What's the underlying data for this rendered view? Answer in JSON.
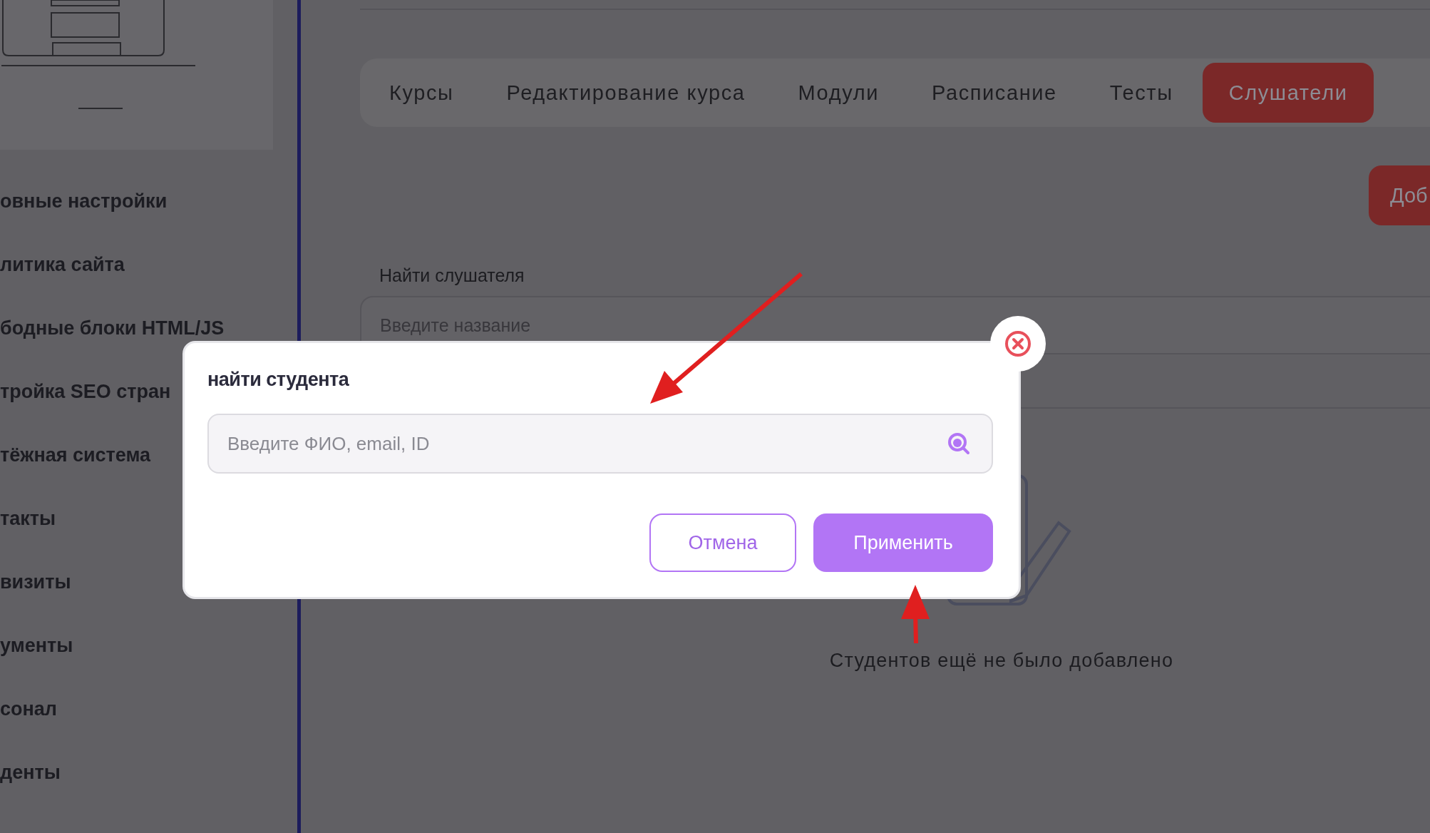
{
  "sidebar": {
    "items": [
      {
        "label": "овные настройки"
      },
      {
        "label": "литика сайта"
      },
      {
        "label": "бодные блоки HTML/JS"
      },
      {
        "label": "тройка SEO стран"
      },
      {
        "label": "тёжная система"
      },
      {
        "label": "такты"
      },
      {
        "label": "визиты"
      },
      {
        "label": "ументы"
      },
      {
        "label": "сонал"
      },
      {
        "label": "денты"
      }
    ]
  },
  "tabs": [
    {
      "label": "Курсы",
      "selected": false
    },
    {
      "label": "Редактирование курса",
      "selected": false
    },
    {
      "label": "Модули",
      "selected": false
    },
    {
      "label": "Расписание",
      "selected": false
    },
    {
      "label": "Тесты",
      "selected": false
    },
    {
      "label": "Слушатели",
      "selected": true
    }
  ],
  "add_button": {
    "label": "Доб"
  },
  "search": {
    "label": "Найти слушателя",
    "placeholder": "Введите название"
  },
  "empty_state": {
    "text": "Студентов ещё не было добавлено"
  },
  "dialog": {
    "title": "найти студента",
    "search": {
      "placeholder": "Введите ФИО, email, ID"
    },
    "buttons": [
      {
        "label": "Отмена",
        "kind": "secondary"
      },
      {
        "label": "Применить",
        "kind": "primary"
      }
    ]
  }
}
